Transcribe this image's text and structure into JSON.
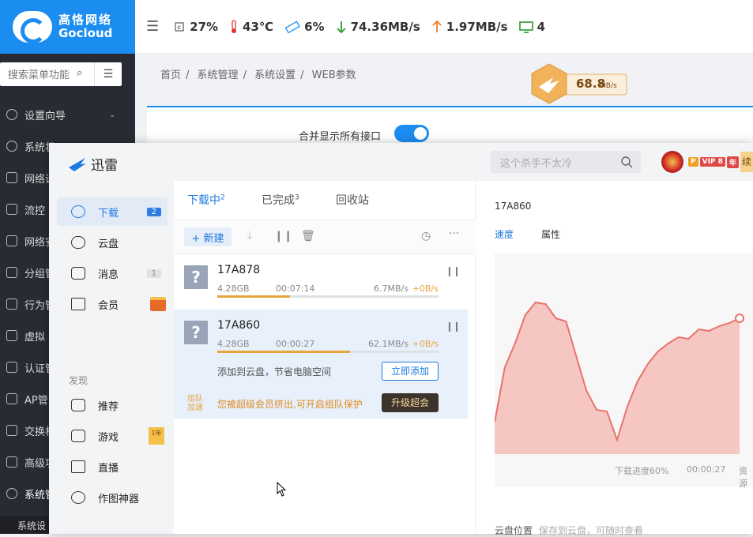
{
  "brand": {
    "cn": "高恪网络",
    "en": "Gocloud",
    "reg": "®"
  },
  "stats": [
    {
      "icon": "cpu-icon",
      "text": "27%"
    },
    {
      "icon": "thermometer-icon",
      "text": "43℃"
    },
    {
      "icon": "memory-icon",
      "text": "6%"
    },
    {
      "icon": "download-arrow-icon",
      "text": "74.36MB/s"
    },
    {
      "icon": "upload-arrow-icon",
      "text": "1.97MB/s"
    },
    {
      "icon": "monitor-icon",
      "text": "4"
    }
  ],
  "admin_menu": {
    "search_placeholder": "搜索菜单功能",
    "items": [
      "设置向导",
      "系统状",
      "网络设",
      "流控",
      "网络安",
      "分组管",
      "行为管",
      "虚拟",
      "认证管",
      "AP管",
      "交换机",
      "高级功",
      "系统管"
    ],
    "sub_item": "系统设"
  },
  "breadcrumb": [
    "首页",
    "系统管理",
    "系统设置",
    "WEB参数"
  ],
  "speed_badge": {
    "value": "68.8",
    "unit": "MB/s"
  },
  "card": {
    "merge_label": "合并显示所有接口",
    "merge_on": true
  },
  "xunlei": {
    "brand": "迅雷",
    "search_placeholder": "这个杀手不太冷",
    "vip_p": "P",
    "vip_label": "VIP 8",
    "vip_year": "年",
    "renew": "续",
    "nav": [
      {
        "label": "下载",
        "count": "2",
        "icon": "download-circle-icon"
      },
      {
        "label": "云盘",
        "icon": "cloud-icon"
      },
      {
        "label": "消息",
        "count": "1",
        "icon": "message-icon"
      },
      {
        "label": "会员",
        "icon": "crown-icon"
      }
    ],
    "discover_label": "发现",
    "discover": [
      {
        "label": "推荐",
        "icon": "star-icon"
      },
      {
        "label": "游戏",
        "icon": "gamepad-icon",
        "badge": "1年"
      },
      {
        "label": "直播",
        "icon": "live-icon"
      },
      {
        "label": "作图神器",
        "icon": "image-editor-icon"
      }
    ],
    "tabs": [
      {
        "label": "下载中",
        "count": "2"
      },
      {
        "label": "已完成",
        "count": "3"
      },
      {
        "label": "回收站"
      }
    ],
    "new_label": "+ 新建",
    "tasks": [
      {
        "name": "17A878",
        "size": "4.28GB",
        "time": "00:07:14",
        "speed": "6.7MB/s",
        "extra": "+0B/s",
        "progress": 0.33
      },
      {
        "name": "17A860",
        "size": "4.28GB",
        "time": "00:00:27",
        "speed": "62.1MB/s",
        "extra": "+0B/s",
        "progress": 0.6,
        "cloud_hint": "添加到云盘，节省电脑空间",
        "cloud_btn": "立即添加",
        "team_tag": "组队\n加速",
        "team_hint": "您被超级会员挤出,可开启组队保护",
        "team_btn": "升级超会"
      }
    ],
    "detail": {
      "title": "17A860",
      "tabs": [
        "速度",
        "属性"
      ],
      "progress_label": "下载进度60%",
      "remaining": "00:00:27",
      "resource": "资源",
      "cloud_position": "云盘位置",
      "cloud_position_hint": "保存到云盘，可随时查看"
    }
  },
  "chart_data": {
    "type": "area",
    "title": "",
    "xlabel": "",
    "ylabel": "",
    "values": [
      0.2,
      0.55,
      0.7,
      0.88,
      0.96,
      0.95,
      0.86,
      0.84,
      0.62,
      0.4,
      0.28,
      0.27,
      0.09,
      0.3,
      0.46,
      0.57,
      0.65,
      0.7,
      0.74,
      0.73,
      0.79,
      0.78,
      0.81,
      0.83,
      0.86
    ],
    "color": "#e8736a",
    "fill": "#f5c6c2"
  }
}
